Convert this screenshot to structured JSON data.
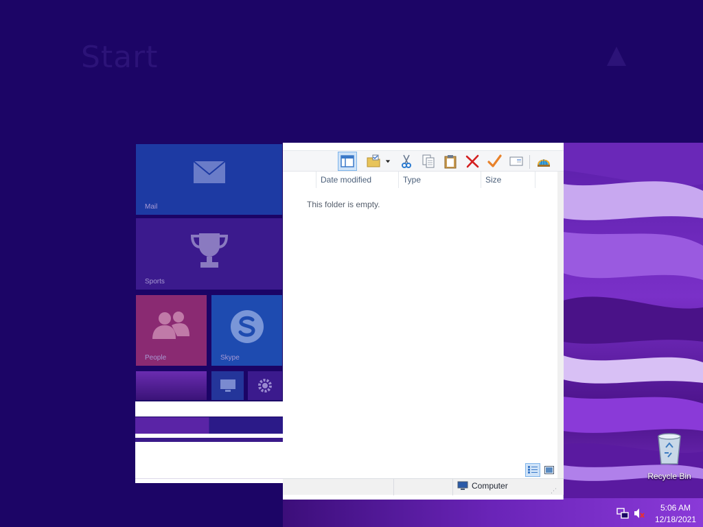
{
  "start": {
    "title": "Start"
  },
  "tiles": {
    "mail": "Mail",
    "sports": "Sports",
    "people": "People",
    "skype": "Skype"
  },
  "explorer": {
    "columns": [
      "Date modified",
      "Type",
      "Size"
    ],
    "empty_message": "This folder is empty.",
    "status_location": "Computer"
  },
  "desktop": {
    "recycle_bin_label": "Recycle Bin"
  },
  "tray": {
    "time": "5:06 AM",
    "date": "12/18/2021"
  },
  "colors": {
    "start_background": "#1c0566",
    "mail_tile": "#1d3aa3",
    "people_tile": "#8a2a72",
    "skype_tile": "#1e4bb0"
  }
}
